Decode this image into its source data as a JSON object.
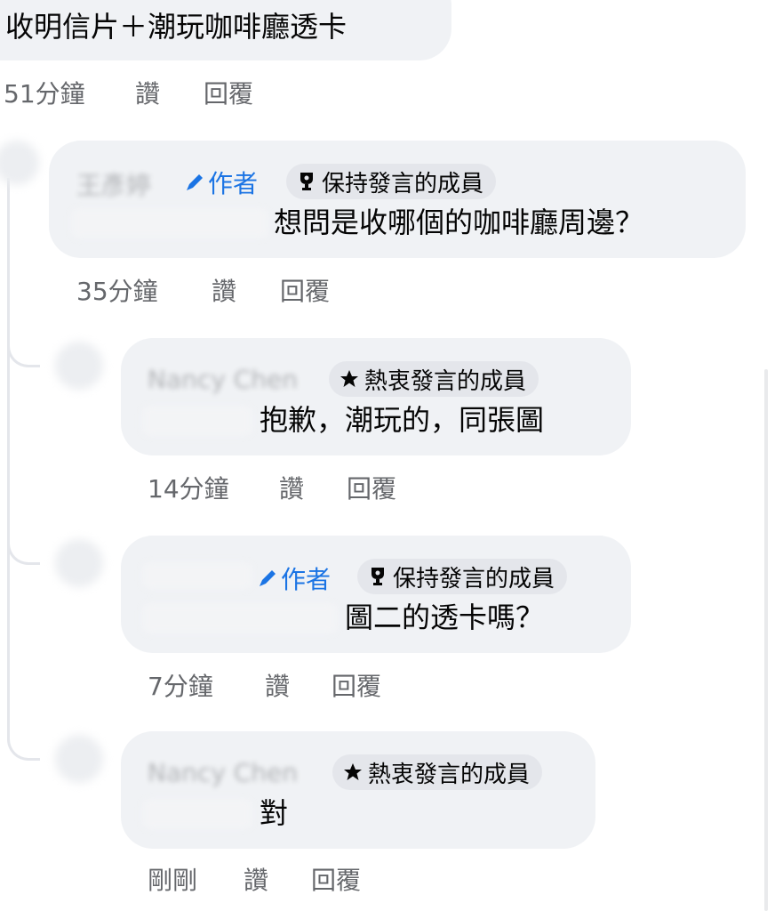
{
  "comments": [
    {
      "text": "收明信片＋潮玩咖啡廳透卡",
      "time": "51分鐘",
      "like": "讚",
      "reply": "回覆"
    },
    {
      "name": "王彥婷",
      "author_label": "作者",
      "badge": "保持發言的成員",
      "text": "想問是收哪個的咖啡廳周邊？",
      "time": "35分鐘",
      "like": "讚",
      "reply": "回覆"
    }
  ],
  "replies": [
    {
      "name": "Nancy Chen",
      "badge": "熱衷發言的成員",
      "text": "抱歉，潮玩的，同張圖",
      "time": "14分鐘",
      "like": "讚",
      "reply": "回覆"
    },
    {
      "author_label": "作者",
      "badge": "保持發言的成員",
      "text": "圖二的透卡嗎？",
      "time": "7分鐘",
      "like": "讚",
      "reply": "回覆"
    },
    {
      "name": "Nancy Chen",
      "badge": "熱衷發言的成員",
      "text": "對",
      "time": "剛剛",
      "like": "讚",
      "reply": "回覆"
    }
  ],
  "icons": {
    "trophy": "trophy-icon",
    "star": "star-icon",
    "pen": "pen-icon"
  },
  "colors": {
    "bubble_bg": "#f0f2f5",
    "author_blue": "#1b74e4",
    "meta_gray": "#65676b",
    "badge_bg": "#e4e6eb"
  }
}
